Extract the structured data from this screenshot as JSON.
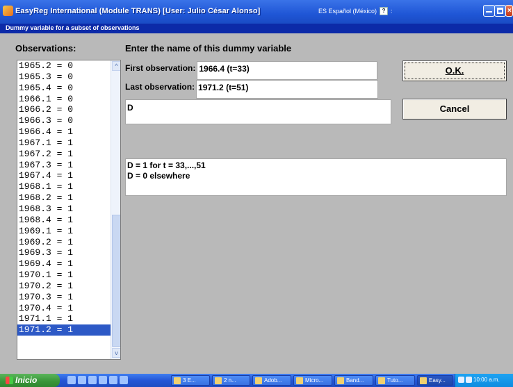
{
  "window": {
    "title": "EasyReg International (Module TRANS) [User: Julio César Alonso]",
    "language_indicator": "ES Español (México)",
    "language_button": "?",
    "language_separator": ":"
  },
  "dialog": {
    "title": "Dummy variable for a subset of observations",
    "observations_label": "Observations:",
    "instruction": "Enter the name of this dummy variable",
    "first_observation_label": "First observation:",
    "first_observation_value": "1966.4 (t=33)",
    "last_observation_label": "Last observation:",
    "last_observation_value": "1971.2 (t=51)",
    "name_input_value": "D",
    "result_line_1": "D = 1 for t = 33,...,51",
    "result_line_2": "D = 0 elsewhere",
    "ok_label": "O.K.",
    "cancel_label": "Cancel",
    "selected_index": 24
  },
  "observations": [
    "1965.2 = 0",
    "1965.3 = 0",
    "1965.4 = 0",
    "1966.1 = 0",
    "1966.2 = 0",
    "1966.3 = 0",
    "1966.4 = 1",
    "1967.1 = 1",
    "1967.2 = 1",
    "1967.3 = 1",
    "1967.4 = 1",
    "1968.1 = 1",
    "1968.2 = 1",
    "1968.3 = 1",
    "1968.4 = 1",
    "1969.1 = 1",
    "1969.2 = 1",
    "1969.3 = 1",
    "1969.4 = 1",
    "1970.1 = 1",
    "1970.2 = 1",
    "1970.3 = 1",
    "1970.4 = 1",
    "1971.1 = 1",
    "1971.2 = 1"
  ],
  "taskbar": {
    "start_label": "Inicio",
    "tasks": [
      "3 E...",
      "2 n...",
      "Adob...",
      "Micro...",
      "Band...",
      "Tuto...",
      "Easy..."
    ],
    "active_task_index": 6,
    "clock": "10:00 a.m."
  },
  "colors": {
    "title_blue": "#1f56d6",
    "subtitle_blue": "#0c2aa8",
    "selection_blue": "#2d59c6",
    "dialog_gray": "#b9b9b9",
    "start_green": "#3a963a"
  }
}
